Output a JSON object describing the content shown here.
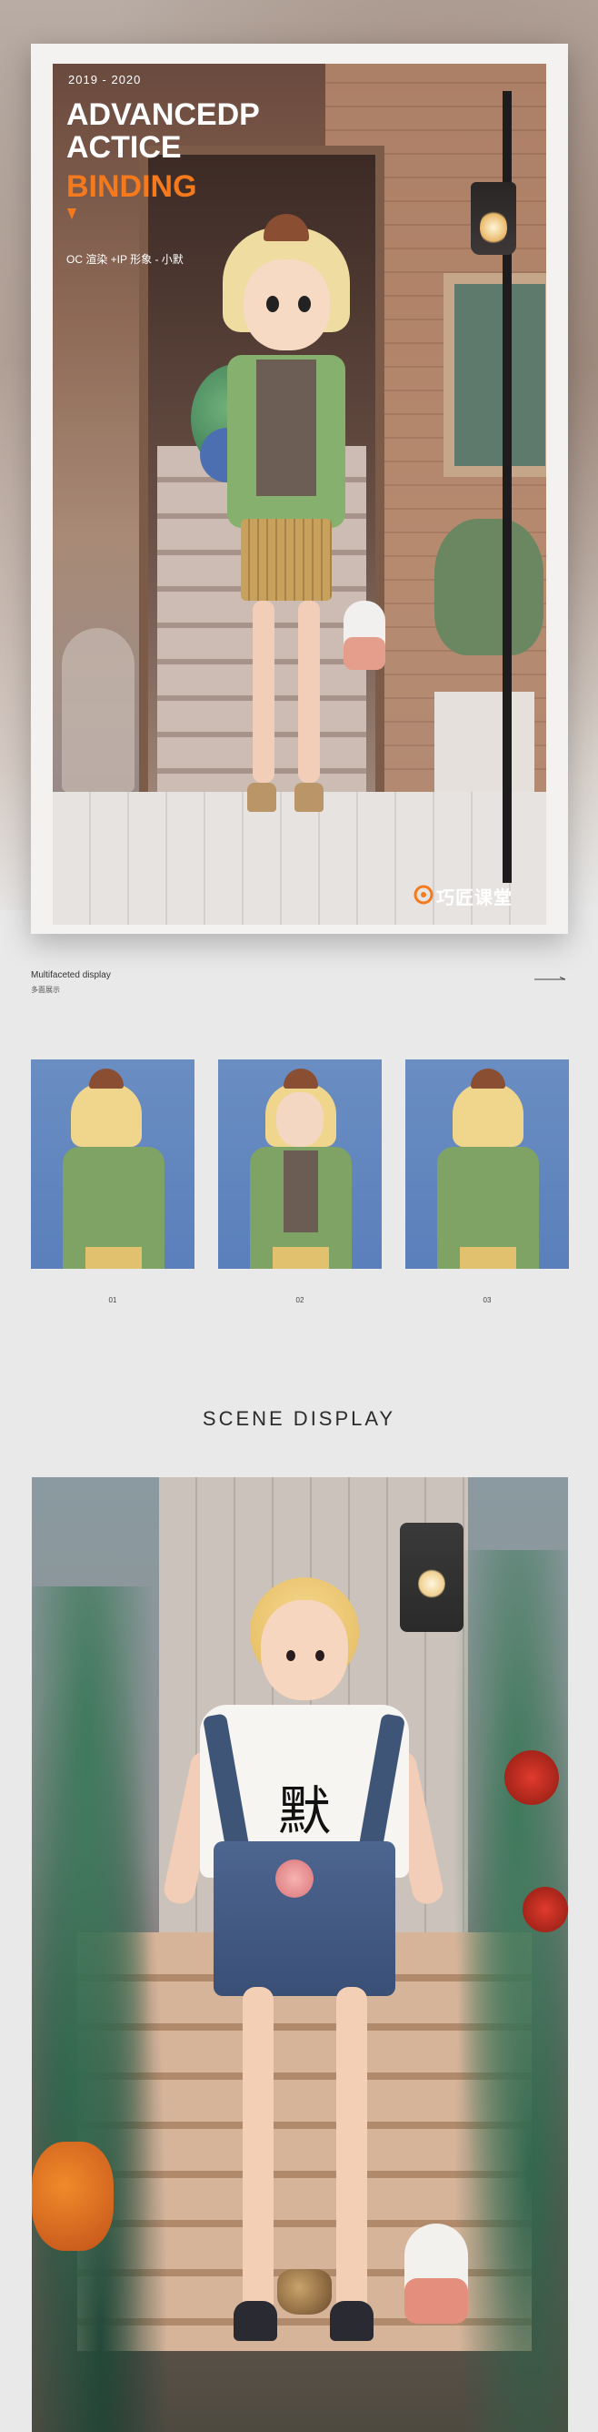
{
  "hero": {
    "year": "2019 - 2020",
    "title_line1": "ADVANCEDP",
    "title_line2": "ACTICE",
    "title_line3": "BINDING",
    "subtitle": "OC 渲染 +IP 形象 - 小默",
    "brand_name": "巧匠课堂",
    "icons": {
      "accent_arrow": "down-arrow-icon",
      "brand_logo": "brand-logo-icon"
    },
    "colors": {
      "accent": "#f47a1d"
    }
  },
  "multifaceted": {
    "title": "Multifaceted display",
    "subtitle": "多面展示",
    "cards": [
      {
        "label": "01"
      },
      {
        "label": "02"
      },
      {
        "label": "03"
      }
    ]
  },
  "scene": {
    "heading": "SCENE DISPLAY",
    "shirt_text": "默"
  }
}
